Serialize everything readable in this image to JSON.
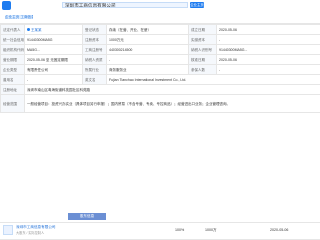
{
  "header": {
    "company_name": "深圳市工商信息有限公司",
    "brand_tag_label": "企业主页",
    "fav_label": "企业主页 工商信息"
  },
  "rows": [
    [
      {
        "label": "法定代表人",
        "value": "王某某",
        "link": true
      },
      {
        "label": "登记状态",
        "value": "存续（在营、开业、在册）"
      },
      {
        "label": "成立日期",
        "value": "2020-05-06"
      }
    ],
    [
      {
        "label": "统一社会信用代码",
        "value": "91440300MA5G"
      },
      {
        "label": "注册资本",
        "value": "1000万元"
      },
      {
        "label": "实缴资本",
        "value": "-"
      }
    ],
    [
      {
        "label": "组织机构代码",
        "value": "MA5G..."
      },
      {
        "label": "工商注册号",
        "value": "440300214500"
      },
      {
        "label": "纳税人识别号",
        "value": "91440300MA5G..."
      }
    ],
    [
      {
        "label": "营业期限",
        "value": "2020-05-06 至 无固定期限"
      },
      {
        "label": "纳税人资质",
        "value": "-"
      },
      {
        "label": "核准日期",
        "value": "2020-05-06"
      }
    ],
    [
      {
        "label": "企业类型",
        "value": "有限责任公司"
      },
      {
        "label": "所属行业",
        "value": "商务服务业"
      },
      {
        "label": "参保人数",
        "value": "-"
      }
    ],
    [
      {
        "label": "曾用名",
        "value": "-"
      },
      {
        "label": "英文名",
        "value": "Fujian Tianchao International Investment Co., Ltd."
      }
    ]
  ],
  "registered_address": {
    "label": "注册地址",
    "value": "深圳市南山区粤海街道科技园社区科苑路"
  },
  "business_scope": {
    "label": "经营范围",
    "value": "一般经营项目：投资兴办实业（具体项目另行申报）；国内贸易（不含专营、专卖、专控商品）；经营进出口业务；企业管理咨询。"
  },
  "shareholder_section": {
    "tab_label": "股东信息",
    "company": "深圳市工商信息有限公司",
    "sub": "大股东 / 实际控制人",
    "ratio": "100%",
    "amount": "1000万",
    "date": "2020-05-06"
  }
}
